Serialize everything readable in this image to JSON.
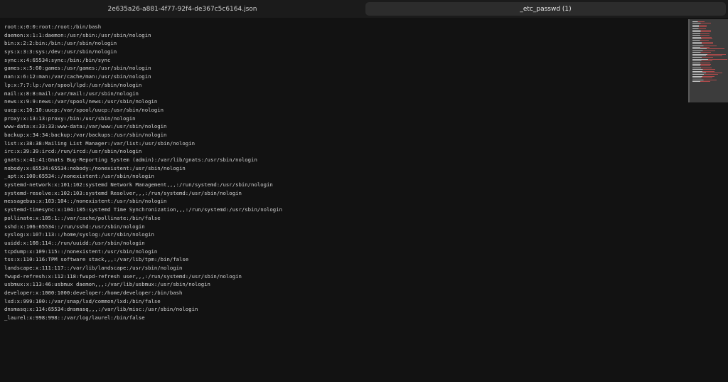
{
  "tabs": [
    {
      "label": "2e635a26-a881-4f77-92f4-de367c5c6164.json",
      "active": false
    },
    {
      "label": "_etc_passwd (1)",
      "active": true
    }
  ],
  "editor": {
    "lines": [
      "root:x:0:0:root:/root:/bin/bash",
      "daemon:x:1:1:daemon:/usr/sbin:/usr/sbin/nologin",
      "bin:x:2:2:bin:/bin:/usr/sbin/nologin",
      "sys:x:3:3:sys:/dev:/usr/sbin/nologin",
      "sync:x:4:65534:sync:/bin:/bin/sync",
      "games:x:5:60:games:/usr/games:/usr/sbin/nologin",
      "man:x:6:12:man:/var/cache/man:/usr/sbin/nologin",
      "lp:x:7:7:lp:/var/spool/lpd:/usr/sbin/nologin",
      "mail:x:8:8:mail:/var/mail:/usr/sbin/nologin",
      "news:x:9:9:news:/var/spool/news:/usr/sbin/nologin",
      "uucp:x:10:10:uucp:/var/spool/uucp:/usr/sbin/nologin",
      "proxy:x:13:13:proxy:/bin:/usr/sbin/nologin",
      "www-data:x:33:33:www-data:/var/www:/usr/sbin/nologin",
      "backup:x:34:34:backup:/var/backups:/usr/sbin/nologin",
      "list:x:38:38:Mailing List Manager:/var/list:/usr/sbin/nologin",
      "irc:x:39:39:ircd:/run/ircd:/usr/sbin/nologin",
      "gnats:x:41:41:Gnats Bug-Reporting System (admin):/var/lib/gnats:/usr/sbin/nologin",
      "nobody:x:65534:65534:nobody:/nonexistent:/usr/sbin/nologin",
      "_apt:x:100:65534::/nonexistent:/usr/sbin/nologin",
      "systemd-network:x:101:102:systemd Network Management,,,:/run/systemd:/usr/sbin/nologin",
      "systemd-resolve:x:102:103:systemd Resolver,,,:/run/systemd:/usr/sbin/nologin",
      "messagebus:x:103:104::/nonexistent:/usr/sbin/nologin",
      "systemd-timesync:x:104:105:systemd Time Synchronization,,,:/run/systemd:/usr/sbin/nologin",
      "pollinate:x:105:1::/var/cache/pollinate:/bin/false",
      "sshd:x:106:65534::/run/sshd:/usr/sbin/nologin",
      "syslog:x:107:113::/home/syslog:/usr/sbin/nologin",
      "uuidd:x:108:114::/run/uuidd:/usr/sbin/nologin",
      "tcpdump:x:109:115::/nonexistent:/usr/sbin/nologin",
      "tss:x:110:116:TPM software stack,,,:/var/lib/tpm:/bin/false",
      "landscape:x:111:117::/var/lib/landscape:/usr/sbin/nologin",
      "fwupd-refresh:x:112:118:fwupd-refresh user,,,:/run/systemd:/usr/sbin/nologin",
      "usbmux:x:113:46:usbmux daemon,,,:/var/lib/usbmux:/usr/sbin/nologin",
      "developer:x:1000:1000:developer:/home/developer:/bin/bash",
      "lxd:x:999:100::/var/snap/lxd/common/lxd:/bin/false",
      "dnsmasq:x:114:65534:dnsmasq,,,:/var/lib/misc:/usr/sbin/nologin",
      "_laurel:x:998:998::/var/log/laurel:/bin/false"
    ]
  },
  "colors": {
    "background": "#121212",
    "text": "#d3d3d3",
    "spellcheck_underline": "#d23c3c",
    "minimap": "#3c3c3c"
  }
}
